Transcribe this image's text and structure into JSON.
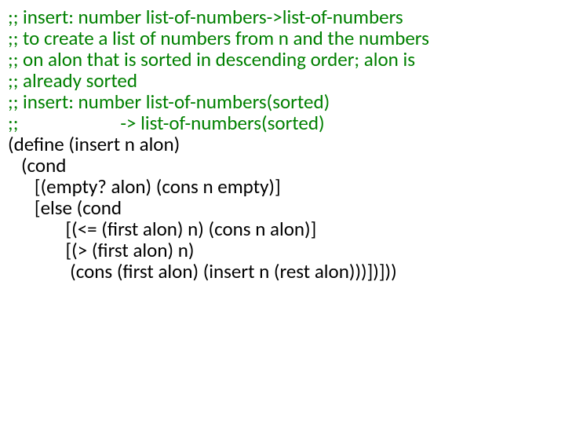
{
  "comments": {
    "l1": ";; insert: number list-of-numbers->list-of-numbers",
    "l2": ";; to create a list of numbers from n and the numbers",
    "l3": ";; on alon that is sorted in descending order; alon is",
    "l4": ";; already sorted",
    "l5": ";; insert: number list-of-numbers(sorted)",
    "l6": ";;                       -> list-of-numbers(sorted)"
  },
  "code": {
    "l1": "(define (insert n alon)",
    "l2": "   (cond",
    "l3": "      [(empty? alon) (cons n empty)]",
    "l4": "      [else (cond",
    "l5": "             [(<= (first alon) n) (cons n alon)]",
    "l6": "             [(> (first alon) n)",
    "l7": "              (cons (first alon) (insert n (rest alon)))])]))"
  }
}
